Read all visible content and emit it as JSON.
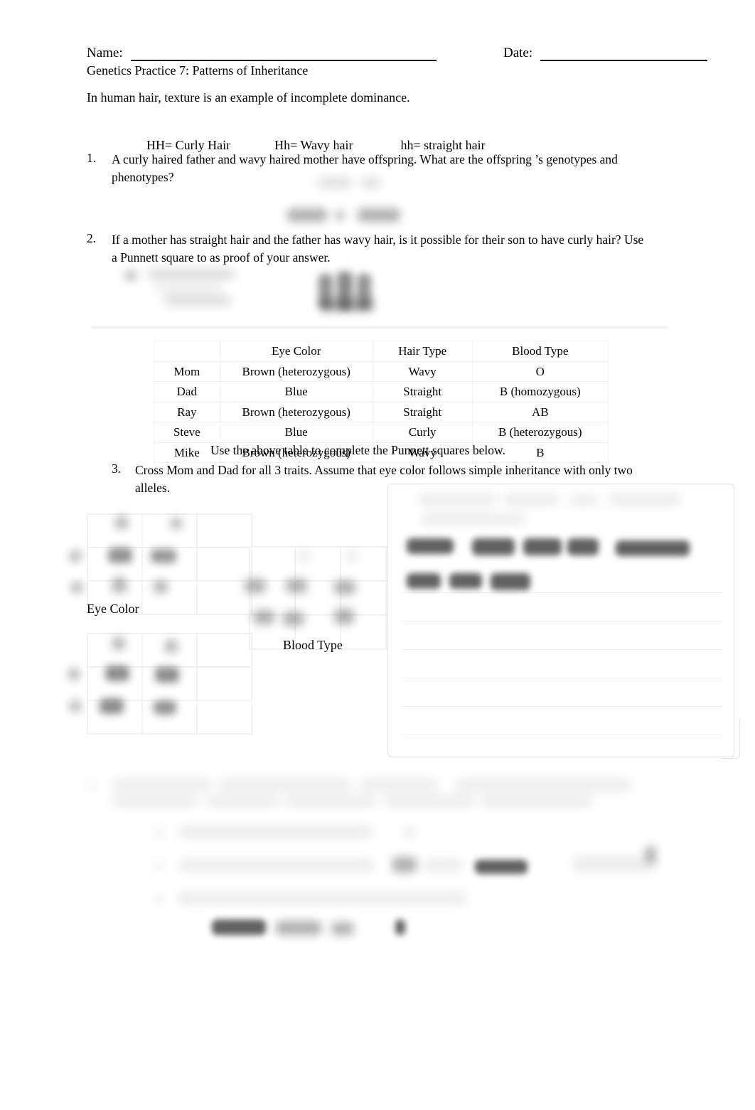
{
  "header": {
    "name_label": "Name:",
    "date_label": "Date:",
    "title": "Genetics Practice 7: Patterns of Inheritance"
  },
  "intro": {
    "sentence": "In human hair, texture is an example of incomplete dominance.",
    "key": {
      "curly": "HH= Curly Hair",
      "wavy": "Hh= Wavy hair",
      "straight": "hh= straight hair"
    }
  },
  "questions": [
    {
      "number": "1.",
      "text": "A curly haired father and wavy haired mother have offspring.      What are the offspring  ’s genotypes and phenotypes?"
    },
    {
      "number": "2.",
      "text": "If a mother has straight hair and the father has wavy hair, is it possible for their son to have curly hair?   Use a Punnett square to as proof of your answer."
    },
    {
      "number": "3.",
      "text": "Cross Mom and Dad for all 3 traits.   Assume that eye color follows simple inheritance with only two alleles."
    }
  ],
  "traits_table": {
    "columns": [
      "",
      "Eye Color",
      "Hair Type",
      "Blood Type"
    ],
    "rows": [
      [
        "Mom",
        "Brown (heterozygous)",
        "Wavy",
        "O"
      ],
      [
        "Dad",
        "Blue",
        "Straight",
        "B (homozygous)"
      ],
      [
        "Ray",
        "Brown (heterozygous)",
        "Straight",
        "AB"
      ],
      [
        "Steve",
        "Blue",
        "Curly",
        "B (heterozygous)"
      ],
      [
        "Mike",
        "Brown (heterozygous)",
        "Wavy",
        "B"
      ]
    ],
    "caption": "Use the above table to complete the Punnett squares below."
  },
  "punnett_labels": {
    "eye_color": "Eye Color",
    "blood_type": "Blood Type"
  },
  "colors": {
    "text": "#000000",
    "rule": "#000000",
    "table_border": "#f0f0f0",
    "separator": "#ededed",
    "answer_box_border": "#e2e2e2",
    "answer_box_rule": "#efefef",
    "ink": "#3a3a3a"
  }
}
